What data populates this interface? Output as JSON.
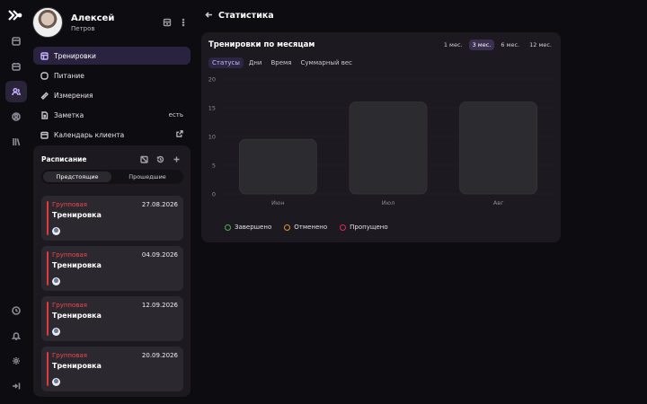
{
  "profile": {
    "name": "Алексей",
    "surname": "Петров"
  },
  "menu": [
    {
      "label": "Тренировки",
      "icon": "dumbbell-icon",
      "active": true
    },
    {
      "label": "Питание",
      "icon": "apple-icon"
    },
    {
      "label": "Измерения",
      "icon": "ruler-icon"
    },
    {
      "label": "Заметка",
      "icon": "note-icon",
      "right": "есть"
    },
    {
      "label": "Календарь клиента",
      "icon": "calendar-icon",
      "right_icon": "external-link-icon"
    }
  ],
  "schedule": {
    "title": "Расписание",
    "tabs": [
      "Предстоящие",
      "Прошедшие"
    ],
    "cards": [
      {
        "type": "Групповая",
        "title": "Тренировка",
        "date": "27.08.2026"
      },
      {
        "type": "Групповая",
        "title": "Тренировка",
        "date": "04.09.2026"
      },
      {
        "type": "Групповая",
        "title": "Тренировка",
        "date": "12.09.2026"
      },
      {
        "type": "Групповая",
        "title": "Тренировка",
        "date": "20.09.2026"
      }
    ]
  },
  "page": {
    "title": "Статистика"
  },
  "stats": {
    "title": "Тренировки по месяцам",
    "periods": [
      "1 мес.",
      "3 мес.",
      "6 мес.",
      "12 мес."
    ],
    "active_period": "3 мес.",
    "tabs": [
      "Статусы",
      "Дни",
      "Время",
      "Суммарный вес"
    ],
    "active_tab": "Статусы",
    "legend": [
      {
        "label": "Завершено",
        "color": "#4caf50"
      },
      {
        "label": "Отменено",
        "color": "#e0912f"
      },
      {
        "label": "Пропущено",
        "color": "#d9304a"
      }
    ]
  },
  "colors": {
    "accent": "#8b6cf0",
    "danger": "#e23b3b",
    "bar": "#2c2b30"
  },
  "chart_data": {
    "type": "bar",
    "categories": [
      "Июн",
      "Июл",
      "Авг"
    ],
    "values": [
      9.5,
      16,
      16
    ],
    "yticks": [
      0,
      5,
      10,
      15,
      20
    ],
    "ylim": [
      0,
      20
    ],
    "grid": true
  }
}
